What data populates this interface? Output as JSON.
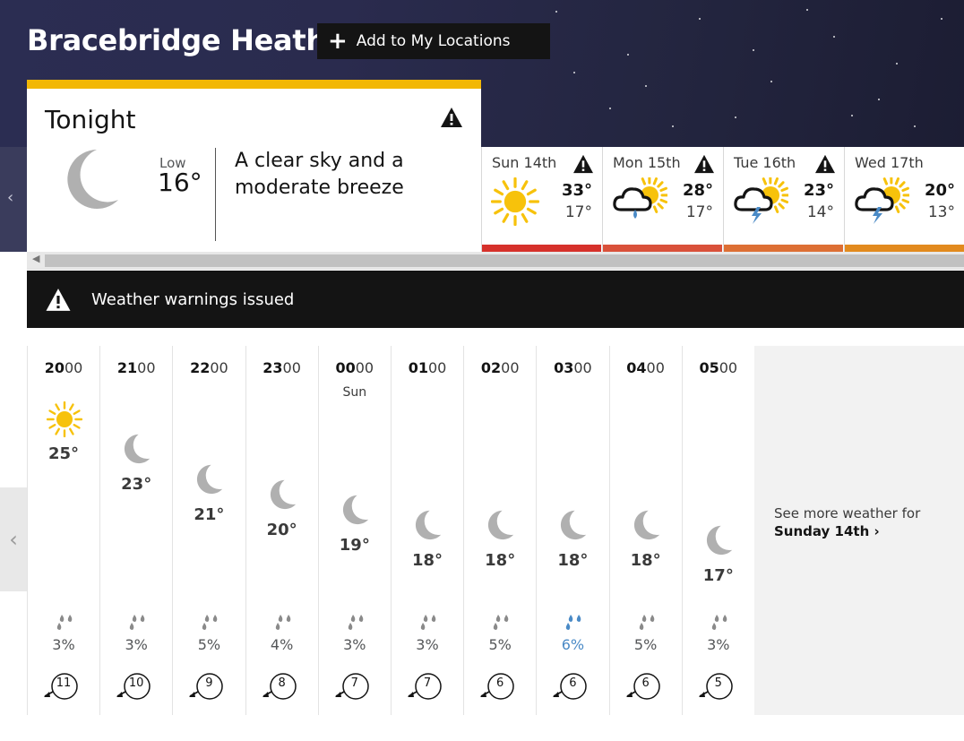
{
  "header": {
    "location": "Bracebridge Heath",
    "add_button_label": "Add to My Locations"
  },
  "tonight": {
    "title": "Tonight",
    "low_label": "Low",
    "low_temp": "16°",
    "description": "A clear sky and a moderate breeze",
    "icon": "moon-icon"
  },
  "days": [
    {
      "name": "Sun 14th",
      "high": "33°",
      "low": "17°",
      "icon": "sunny-icon",
      "bar_color": "#d6312b",
      "warning": true
    },
    {
      "name": "Mon 15th",
      "high": "28°",
      "low": "17°",
      "icon": "thundery-shower-icon",
      "bar_color": "#d9513a",
      "warning": true
    },
    {
      "name": "Tue 16th",
      "high": "23°",
      "low": "14°",
      "icon": "thunderstorm-icon",
      "bar_color": "#dd6f34",
      "warning": true
    },
    {
      "name": "Wed 17th",
      "high": "20°",
      "low": "13°",
      "icon": "thunderstorm-icon",
      "bar_color": "#e28a1e",
      "warning": false
    }
  ],
  "warning_banner": {
    "text": "Weather warnings issued"
  },
  "hours": [
    {
      "hh": "20",
      "mm": "00",
      "day": "",
      "temp": "25°",
      "temp_level": 25,
      "icon": "sunny-icon",
      "rain": "3%",
      "rain_highlight": false,
      "wind": "11"
    },
    {
      "hh": "21",
      "mm": "00",
      "day": "",
      "temp": "23°",
      "temp_level": 23,
      "icon": "moon-icon",
      "rain": "3%",
      "rain_highlight": false,
      "wind": "10"
    },
    {
      "hh": "22",
      "mm": "00",
      "day": "",
      "temp": "21°",
      "temp_level": 21,
      "icon": "moon-icon",
      "rain": "5%",
      "rain_highlight": false,
      "wind": "9"
    },
    {
      "hh": "23",
      "mm": "00",
      "day": "",
      "temp": "20°",
      "temp_level": 20,
      "icon": "moon-icon",
      "rain": "4%",
      "rain_highlight": false,
      "wind": "8"
    },
    {
      "hh": "00",
      "mm": "00",
      "day": "Sun",
      "temp": "19°",
      "temp_level": 19,
      "icon": "moon-icon",
      "rain": "3%",
      "rain_highlight": false,
      "wind": "7"
    },
    {
      "hh": "01",
      "mm": "00",
      "day": "",
      "temp": "18°",
      "temp_level": 18,
      "icon": "moon-icon",
      "rain": "3%",
      "rain_highlight": false,
      "wind": "7"
    },
    {
      "hh": "02",
      "mm": "00",
      "day": "",
      "temp": "18°",
      "temp_level": 18,
      "icon": "moon-icon",
      "rain": "5%",
      "rain_highlight": false,
      "wind": "6"
    },
    {
      "hh": "03",
      "mm": "00",
      "day": "",
      "temp": "18°",
      "temp_level": 18,
      "icon": "moon-icon",
      "rain": "6%",
      "rain_highlight": true,
      "wind": "6"
    },
    {
      "hh": "04",
      "mm": "00",
      "day": "",
      "temp": "18°",
      "temp_level": 18,
      "icon": "moon-icon",
      "rain": "5%",
      "rain_highlight": false,
      "wind": "6"
    },
    {
      "hh": "05",
      "mm": "00",
      "day": "",
      "temp": "17°",
      "temp_level": 17,
      "icon": "moon-icon",
      "rain": "3%",
      "rain_highlight": false,
      "wind": "5"
    }
  ],
  "see_more": {
    "line1": "See more weather for",
    "line2": "Sunday 14th"
  },
  "colors": {
    "accent_yellow": "#f2b705",
    "sun": "#f7c20b",
    "moon": "#b0b0b0",
    "rain_highlight": "#4a8ac6"
  }
}
